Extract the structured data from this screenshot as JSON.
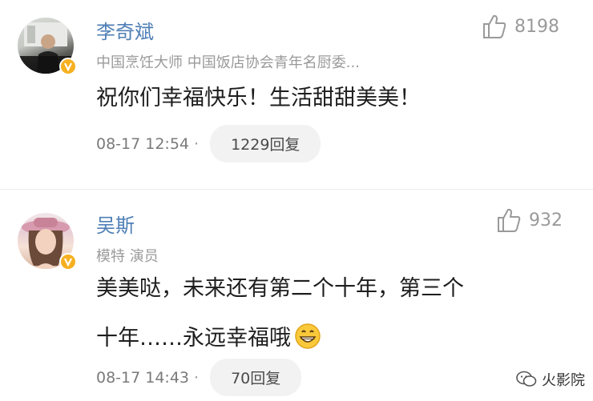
{
  "comments": [
    {
      "username": "李奇斌",
      "subtitle": "中国烹饪大师 中国饭店协会青年名厨委...",
      "likes": "8198",
      "text": "祝你们幸福快乐！生活甜甜美美！",
      "timestamp": "08-17 12:54",
      "separator": "·",
      "replies": "1229回复",
      "avatar_icon": "avatar-man-at-piano",
      "badge_icon": "verified-v-icon"
    },
    {
      "username": "吴斯",
      "subtitle": "模特 演员",
      "likes": "932",
      "text_line1": "美美哒，未来还有第二个十年，第三个",
      "text_line2": "十年……永远幸福哦",
      "emoji": "grin-emoji",
      "timestamp": "08-17 14:43",
      "separator": "·",
      "replies": "70回复",
      "avatar_icon": "avatar-woman-pink-hat",
      "badge_icon": "verified-v-icon"
    }
  ],
  "watermark": {
    "text": "火影院",
    "icon": "wechat-icon"
  },
  "colors": {
    "username": "#4f7fb6",
    "meta": "#9a9a9a",
    "badge": "#f6b020",
    "pill_bg": "#f2f2f2"
  }
}
